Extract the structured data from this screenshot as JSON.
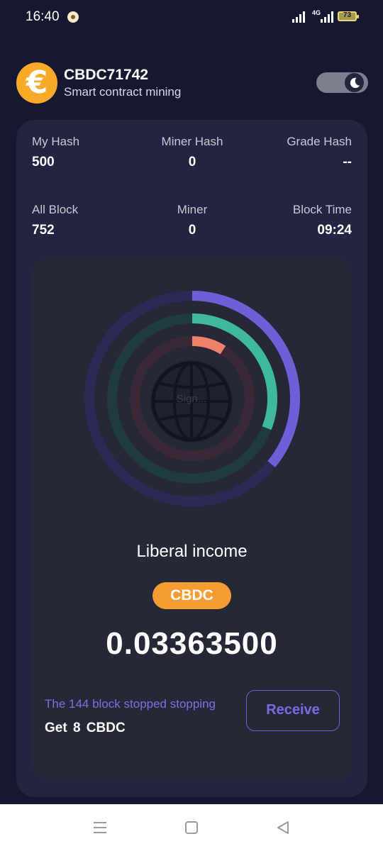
{
  "status_bar": {
    "time": "16:40",
    "network": "4G",
    "battery": "73",
    "icons": [
      "notification-icon",
      "signal-icon",
      "battery-icon"
    ]
  },
  "header": {
    "logo_icon": "euro-coin-icon",
    "logo_glyph": "€",
    "title": "CBDC71742",
    "subtitle": "Smart contract mining",
    "theme_toggle_icon": "moon-icon"
  },
  "stats": [
    {
      "label": "My Hash",
      "value": "500"
    },
    {
      "label": "Miner Hash",
      "value": "0"
    },
    {
      "label": "Grade Hash",
      "value": "--"
    },
    {
      "label": "All Block",
      "value": "752"
    },
    {
      "label": "Miner",
      "value": "0"
    },
    {
      "label": "Block Time",
      "value": "09:24"
    }
  ],
  "progress_rings": [
    {
      "name": "outer",
      "fraction": 0.36,
      "color": "#6e5fd6",
      "track": "#2a2a55"
    },
    {
      "name": "middle",
      "fraction": 0.31,
      "color": "#3eb99b",
      "track": "#1f3a40"
    },
    {
      "name": "inner",
      "fraction": 0.09,
      "color": "#f0806a",
      "track": "#3a2836"
    }
  ],
  "sign": {
    "label": "Sign...",
    "icon": "globe-icon"
  },
  "income": {
    "title": "Liberal income",
    "coin": "CBDC",
    "value": "0.03363500"
  },
  "block_note": "The 144 block stopped stopping",
  "reward": "Get  8  CBDC",
  "receive_label": "Receive",
  "colors": {
    "background": "#161832",
    "card": "#222441",
    "panel": "#262838",
    "accent_purple": "#6e5fd6",
    "accent_orange": "#f59c33"
  },
  "nav": [
    "menu-icon",
    "home-icon",
    "back-icon"
  ]
}
